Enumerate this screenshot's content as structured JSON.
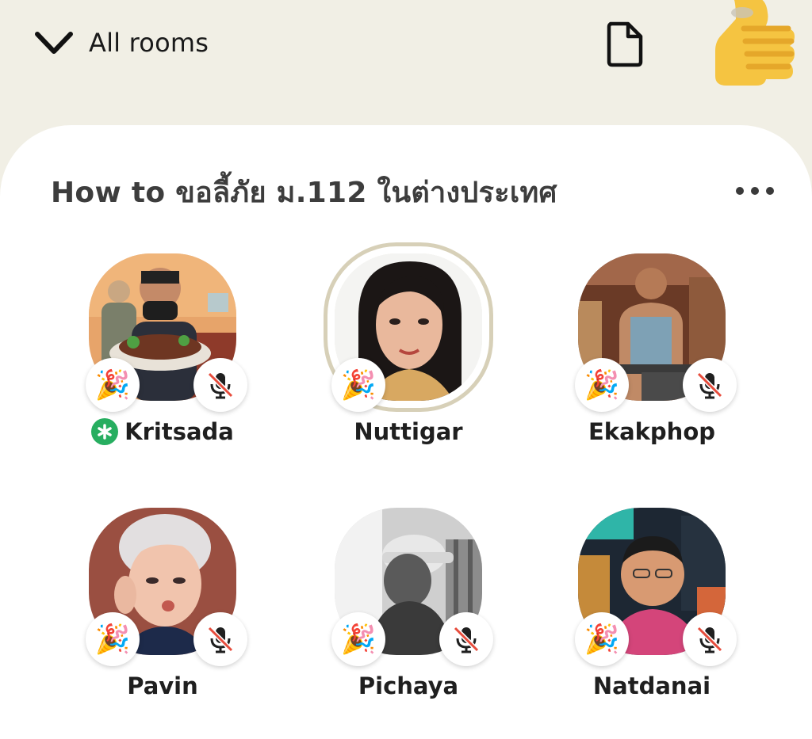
{
  "header": {
    "back_label": "All rooms",
    "back_icon": "chevron-down-icon",
    "doc_icon": "document-icon",
    "avatar_icon": "thumbs-up-icon"
  },
  "room": {
    "title": "How to ขอลี้ภัย ม.112 ในต่างประเทศ",
    "more_icon": "more-horizontal-icon"
  },
  "speakers": [
    {
      "name": "Kritsada",
      "moderator": true,
      "speaking": false,
      "muted": true
    },
    {
      "name": "Nuttigar",
      "moderator": false,
      "speaking": true,
      "muted": false
    },
    {
      "name": "Ekakphop",
      "moderator": false,
      "speaking": false,
      "muted": true
    },
    {
      "name": "Pavin",
      "moderator": false,
      "speaking": false,
      "muted": true
    },
    {
      "name": "Pichaya",
      "moderator": false,
      "speaking": false,
      "muted": true
    },
    {
      "name": "Natdanai",
      "moderator": false,
      "speaking": false,
      "muted": true
    }
  ],
  "colors": {
    "background": "#f1efe5",
    "card": "#ffffff",
    "moderator_badge": "#27ae60",
    "speaking_ring": "#d7d0b8",
    "mute_slash": "#e74c3c"
  }
}
